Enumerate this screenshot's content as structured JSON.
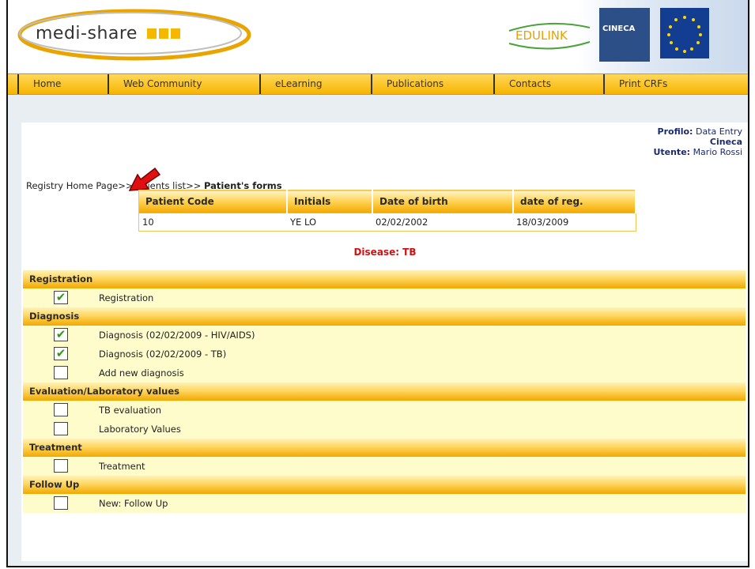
{
  "header": {
    "logo_text": "medi-share",
    "partner_logo": "EDULINK",
    "cineca_logo": "CINECA",
    "colors": {
      "accent": "#f5b800",
      "brand_blue": "#2d4f87",
      "eu_blue": "#123d91"
    }
  },
  "nav": [
    {
      "label": "Home"
    },
    {
      "label": "Web Community"
    },
    {
      "label": "eLearning"
    },
    {
      "label": "Publications"
    },
    {
      "label": "Contacts"
    },
    {
      "label": "Print CRFs"
    }
  ],
  "profile": {
    "profilo_label": "Profilo:",
    "profilo_value": "Data Entry",
    "org": "Cineca",
    "utente_label": "Utente:",
    "utente_value": "Mario Rossi"
  },
  "breadcrumb": {
    "home": "Registry Home Page",
    "sep1": ">>",
    "list": "Patients list",
    "sep2": ">>",
    "current": "Patient's forms"
  },
  "patient_table": {
    "headers": [
      "Patient Code",
      "Initials",
      "Date of birth",
      "date of reg."
    ],
    "row": [
      "10",
      "YE LO",
      "02/02/2002",
      "18/03/2009"
    ]
  },
  "disease": "Disease: TB",
  "sections": [
    {
      "title": "Registration",
      "items": [
        {
          "label": "Registration",
          "checked": true
        }
      ]
    },
    {
      "title": "Diagnosis",
      "items": [
        {
          "label": "Diagnosis (02/02/2009 - HIV/AIDS)",
          "checked": true
        },
        {
          "label": "Diagnosis (02/02/2009 - TB)",
          "checked": true
        },
        {
          "label": "Add new diagnosis",
          "checked": false
        }
      ]
    },
    {
      "title": "Evaluation/Laboratory values",
      "items": [
        {
          "label": "TB evaluation",
          "checked": false
        },
        {
          "label": "Laboratory Values",
          "checked": false
        }
      ]
    },
    {
      "title": "Treatment",
      "items": [
        {
          "label": "Treatment",
          "checked": false
        }
      ]
    },
    {
      "title": "Follow Up",
      "items": [
        {
          "label": "New: Follow Up",
          "checked": false
        }
      ]
    }
  ],
  "check_glyph": "✔"
}
